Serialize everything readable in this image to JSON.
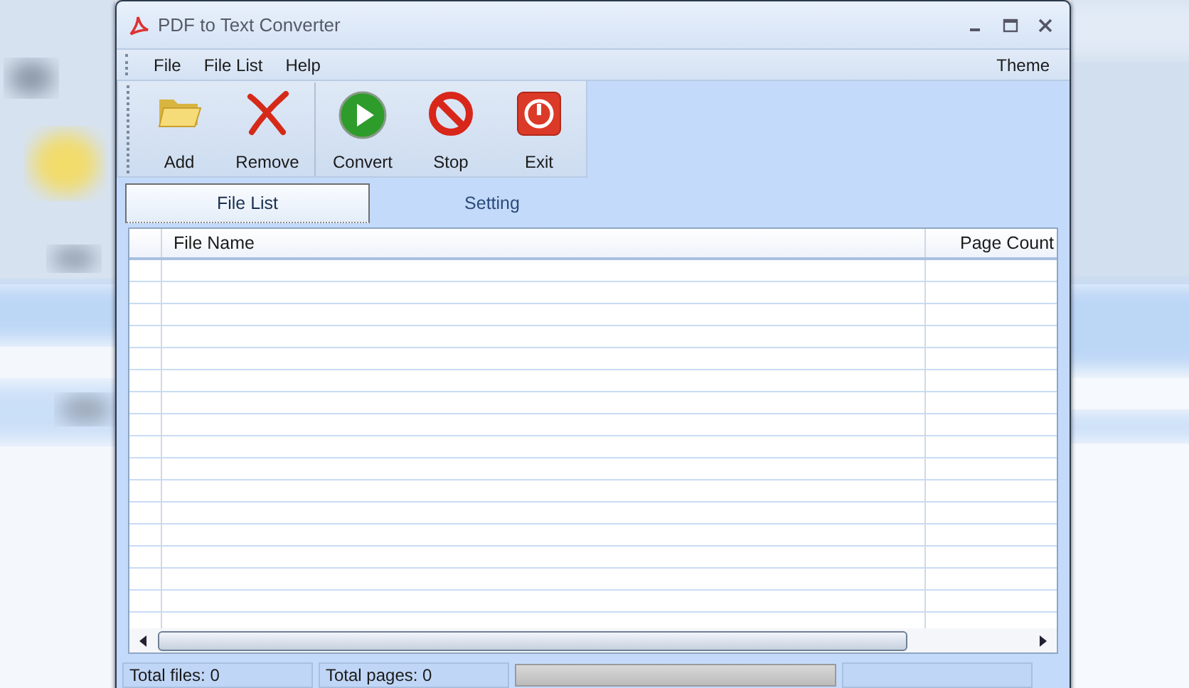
{
  "window": {
    "title": "PDF to Text Converter"
  },
  "menu": [
    {
      "label": "File"
    },
    {
      "label": "File List"
    },
    {
      "label": "Help"
    }
  ],
  "menu_right": {
    "label": "Theme"
  },
  "toolbar": [
    {
      "label": "Add",
      "kind": "folder"
    },
    {
      "label": "Remove",
      "kind": "cross"
    },
    {
      "label": "Convert",
      "kind": "play"
    },
    {
      "label": "Stop",
      "kind": "stop"
    },
    {
      "label": "Exit",
      "kind": "power"
    }
  ],
  "tabs": [
    {
      "label": "File List",
      "selected": true
    },
    {
      "label": "Setting",
      "selected": false
    }
  ],
  "table": {
    "columns": [
      "File Name",
      "Page Count"
    ]
  },
  "status_bar": {
    "total_files": "Total files: 0",
    "total_pages": "Total pages: 0",
    "progress": {
      "level": 0
    }
  }
}
